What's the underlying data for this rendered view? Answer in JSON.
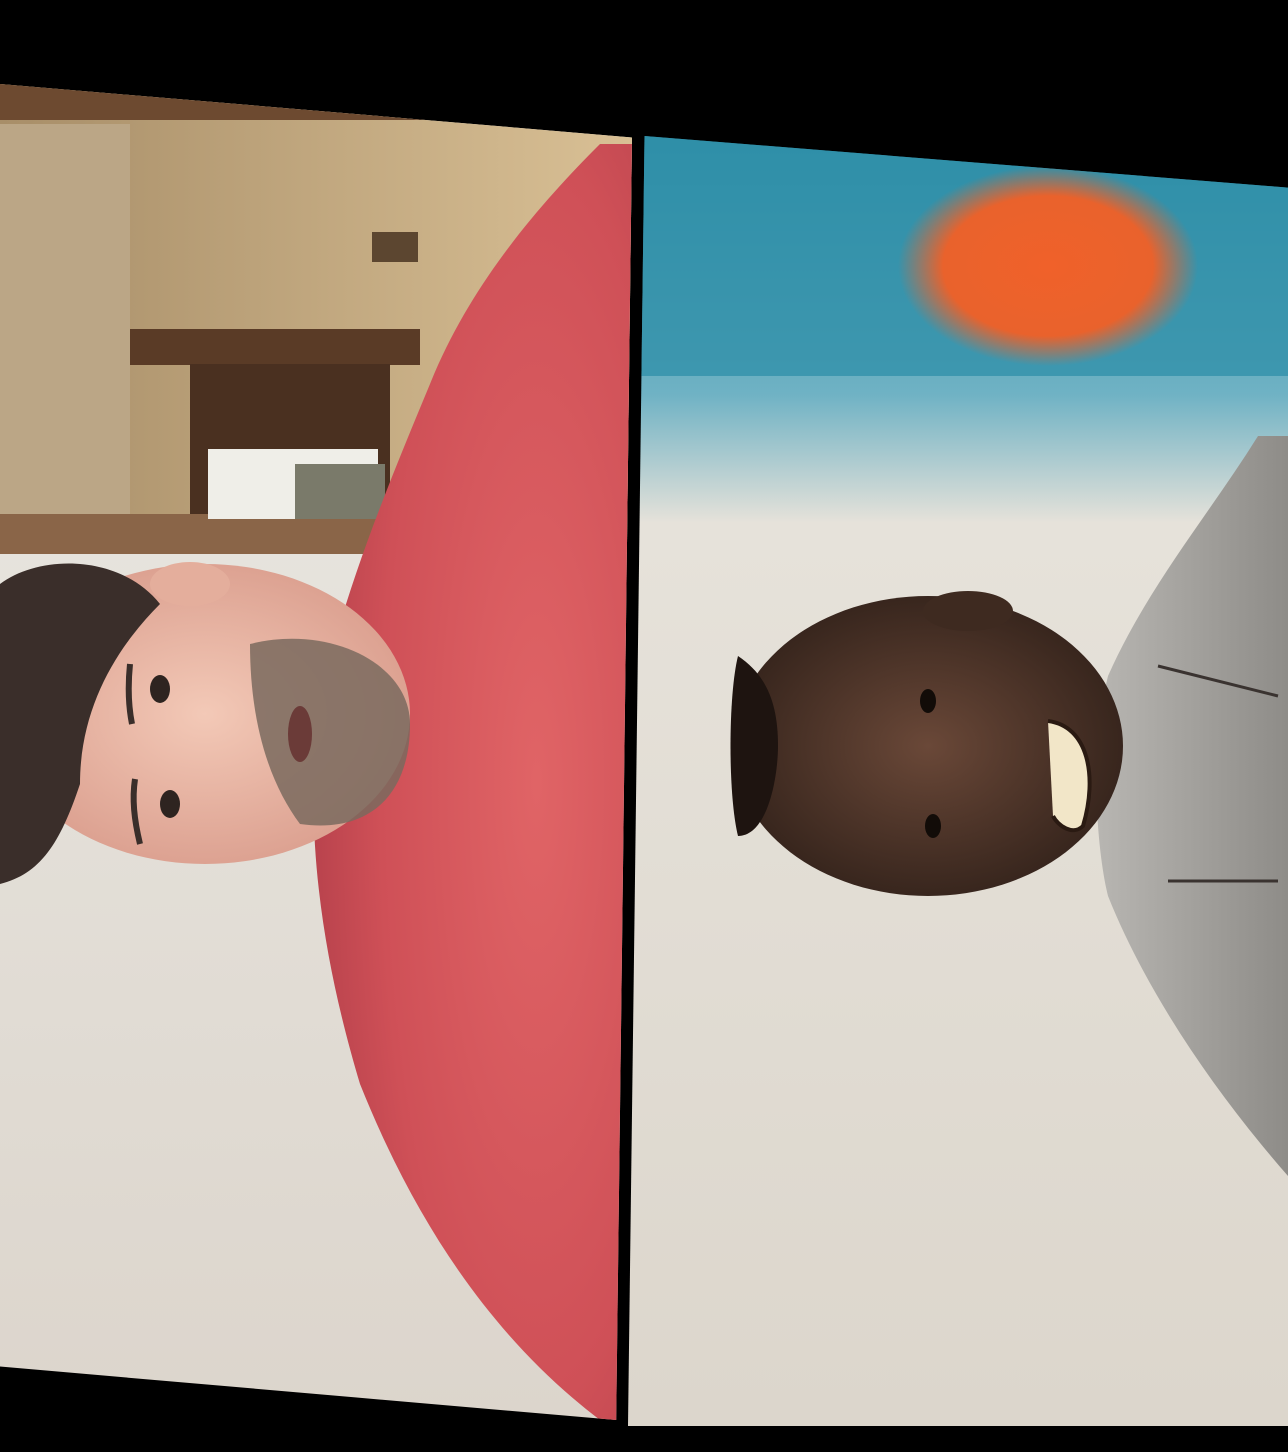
{
  "call": {
    "layout": "two-tile-grid",
    "participants": [
      {
        "id": "left",
        "orientation": "rotated-90-cw"
      },
      {
        "id": "right",
        "orientation": "rotated-90-cw"
      }
    ]
  },
  "colors": {
    "background": "#000000",
    "left_wall": "#c9b08a",
    "left_shirt": "#d9595e",
    "left_ceiling": "#e8e3dc",
    "right_backdrop_blue": "#2f8fa8",
    "right_backdrop_orange": "#e9622c",
    "right_wall": "#e6e2da",
    "right_shirt": "#a9a7a3"
  }
}
